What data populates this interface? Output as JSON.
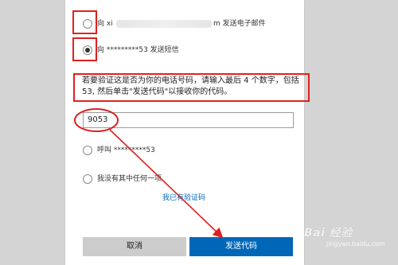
{
  "options": {
    "email": {
      "prefix": "向 xi",
      "suffix": "m 发送电子邮件",
      "checked": false
    },
    "sms": {
      "label": "向 *********53 发送短信",
      "checked": true
    },
    "call": {
      "label": "呼叫 *********53",
      "checked": false
    },
    "none": {
      "label": "我没有其中任何一项",
      "checked": false
    }
  },
  "instructions": "若要验证这是否为你的电话号码，请输入最后 4 个数字，包括 53, 然后单击\"发送代码\"以接收你的代码。",
  "code_input": {
    "value": "9053"
  },
  "have_code_link": "我已有验证码",
  "buttons": {
    "cancel": "取消",
    "send": "发送代码"
  },
  "watermark": {
    "text": "Bai 经验",
    "sub": "jingyan.baidu.com"
  },
  "colors": {
    "accent_blue": "#0067b8",
    "annotation_red": "#e02020"
  }
}
